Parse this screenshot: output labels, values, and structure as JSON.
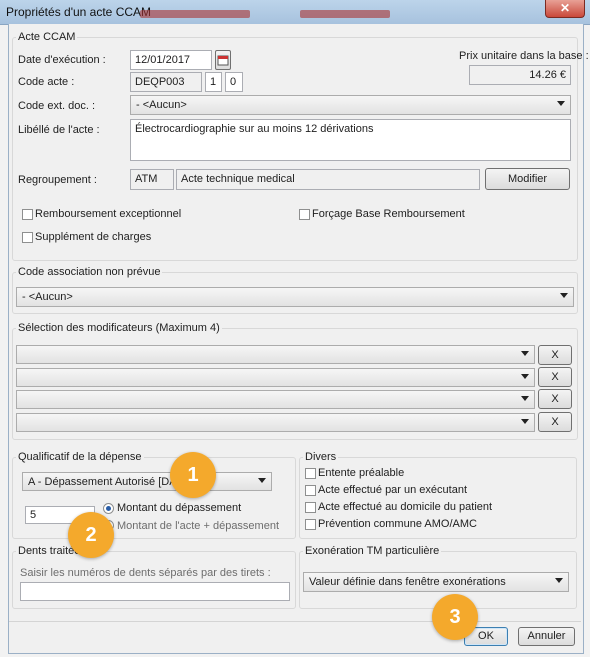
{
  "window": {
    "title": "Propriétés d'un acte CCAM",
    "close_glyph": "✕"
  },
  "acte": {
    "group_label": "Acte CCAM",
    "date_label": "Date d'exécution :",
    "date_value": "12/01/2017",
    "code_label": "Code acte :",
    "code_value": "DEQP003",
    "code_activite": "1",
    "code_phase": "0",
    "prix_label": "Prix unitaire dans la base :",
    "prix_value": "14.26 €",
    "ext_doc_label": "Code ext. doc. :",
    "ext_doc_value": "- <Aucun>",
    "libelle_label": "Libéllé de l'acte :",
    "libelle_value": "Électrocardiographie sur au moins 12 dérivations",
    "regroupement_label": "Regroupement :",
    "regroupement_code": "ATM",
    "regroupement_desc": "Acte technique medical",
    "modifier_label": "Modifier",
    "remboursement_exceptionnel": "Remboursement exceptionnel",
    "forcage_base": "Forçage Base Remboursement",
    "supplement_charges": "Supplément de charges"
  },
  "association": {
    "group_label": "Code association non prévue",
    "value": "- <Aucun>"
  },
  "modificateurs": {
    "group_label": "Sélection des modificateurs (Maximum 4)",
    "clear_label": "X",
    "rows": [
      "",
      "",
      "",
      ""
    ]
  },
  "qualificatif": {
    "group_label": "Qualificatif de la dépense",
    "value": "A - Dépassement Autorisé [DA]",
    "amount": "5",
    "radio_depassement": "Montant du dépassement",
    "radio_total": "Montant de l'acte + dépassement"
  },
  "divers": {
    "group_label": "Divers",
    "items": [
      "Entente préalable",
      "Acte effectué par un exécutant",
      "Acte effectué au domicile du patient",
      "Prévention commune AMO/AMC"
    ]
  },
  "dents": {
    "group_label": "Dents traitées",
    "hint": "Saisir les numéros de dents séparés par des tirets :",
    "value": ""
  },
  "exoneration": {
    "group_label": "Exonération TM particulière",
    "value": "Valeur définie dans fenêtre exonérations"
  },
  "footer": {
    "ok_label": "OK",
    "cancel_label": "Annuler"
  },
  "badges": [
    "1",
    "2",
    "3"
  ]
}
